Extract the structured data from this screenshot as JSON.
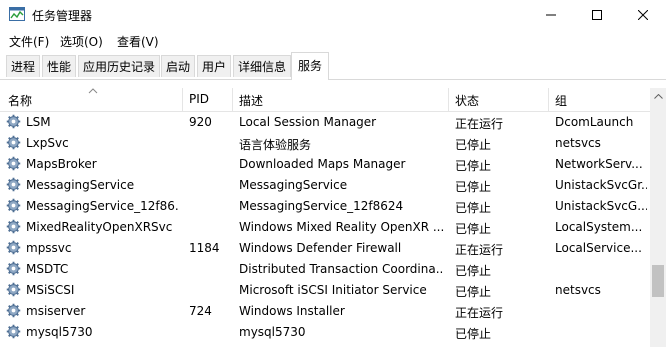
{
  "window": {
    "title": "任务管理器"
  },
  "menu": [
    "文件(F)",
    "选项(O)",
    "查看(V)"
  ],
  "tabs": [
    "进程",
    "性能",
    "应用历史记录",
    "启动",
    "用户",
    "详细信息",
    "服务"
  ],
  "active_tab": "服务",
  "columns": {
    "name": "名称",
    "pid": "PID",
    "desc": "描述",
    "status": "状态",
    "group": "组"
  },
  "rows": [
    {
      "name": "LSM",
      "pid": "920",
      "desc": "Local Session Manager",
      "status": "正在运行",
      "group": "DcomLaunch"
    },
    {
      "name": "LxpSvc",
      "pid": "",
      "desc": "语言体验服务",
      "status": "已停止",
      "group": "netsvcs"
    },
    {
      "name": "MapsBroker",
      "pid": "",
      "desc": "Downloaded Maps Manager",
      "status": "已停止",
      "group": "NetworkServ..."
    },
    {
      "name": "MessagingService",
      "pid": "",
      "desc": "MessagingService",
      "status": "已停止",
      "group": "UnistackSvcGr..."
    },
    {
      "name": "MessagingService_12f86...",
      "pid": "",
      "desc": "MessagingService_12f8624",
      "status": "已停止",
      "group": "UnistackSvcG..."
    },
    {
      "name": "MixedRealityOpenXRSvc",
      "pid": "",
      "desc": "Windows Mixed Reality OpenXR ...",
      "status": "已停止",
      "group": "LocalSystem..."
    },
    {
      "name": "mpssvc",
      "pid": "1184",
      "desc": "Windows Defender Firewall",
      "status": "正在运行",
      "group": "LocalService..."
    },
    {
      "name": "MSDTC",
      "pid": "",
      "desc": "Distributed Transaction Coordina...",
      "status": "已停止",
      "group": ""
    },
    {
      "name": "MSiSCSI",
      "pid": "",
      "desc": "Microsoft iSCSI Initiator Service",
      "status": "已停止",
      "group": "netsvcs"
    },
    {
      "name": "msiserver",
      "pid": "724",
      "desc": "Windows Installer",
      "status": "正在运行",
      "group": ""
    },
    {
      "name": "mysql5730",
      "pid": "",
      "desc": "mysql5730",
      "status": "已停止",
      "group": ""
    }
  ]
}
